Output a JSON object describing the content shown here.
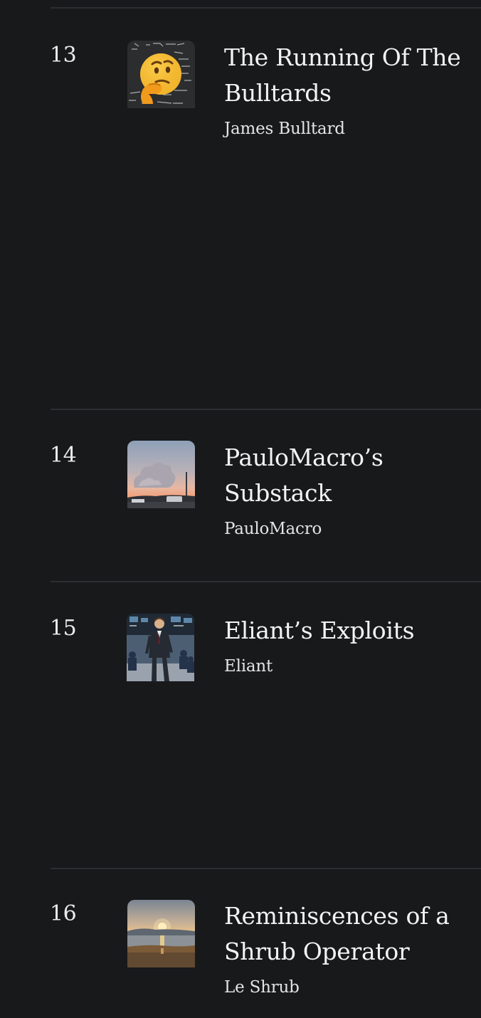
{
  "colors": {
    "background": "#18191b",
    "divider": "#2c2e31",
    "text": "#f3f3f3"
  },
  "leaderboard": {
    "items": [
      {
        "rank": "13",
        "title": "The Running Of The Bulltards",
        "author": "James Bulltard",
        "thumbnail": "thinking-face-chalkboard-thumbnail"
      },
      {
        "rank": "14",
        "title": "PauloMacro’s Substack",
        "author": "PauloMacro",
        "thumbnail": "sunset-clouds-thumbnail"
      },
      {
        "rank": "15",
        "title": "Eliant’s Exploits",
        "author": "Eliant",
        "thumbnail": "trader-suit-thumbnail"
      },
      {
        "rank": "16",
        "title": "Reminiscences of a Shrub Operator",
        "author": "Le Shrub",
        "thumbnail": "beach-sunset-thumbnail"
      }
    ]
  }
}
